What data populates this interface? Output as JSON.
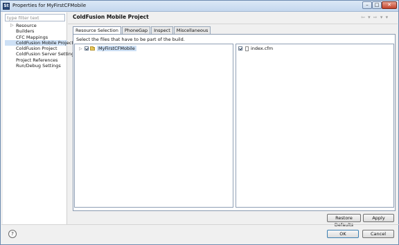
{
  "window": {
    "title": "Properties for MyFirstCFMobile",
    "app_icon": "St",
    "controls": {
      "minimize": "–",
      "maximize": "□",
      "close": "✕"
    }
  },
  "sidebar": {
    "filter_placeholder": "type filter text",
    "items": [
      {
        "label": "Resource",
        "expandable": true,
        "selected": false
      },
      {
        "label": "Builders",
        "expandable": false,
        "selected": false
      },
      {
        "label": "CFC Mappings",
        "expandable": false,
        "selected": false
      },
      {
        "label": "ColdFusion Mobile Project",
        "expandable": false,
        "selected": true
      },
      {
        "label": "ColdFusion Project",
        "expandable": false,
        "selected": false
      },
      {
        "label": "ColdFusion Server Settings",
        "expandable": false,
        "selected": false
      },
      {
        "label": "Project References",
        "expandable": false,
        "selected": false
      },
      {
        "label": "Run/Debug Settings",
        "expandable": false,
        "selected": false
      }
    ]
  },
  "main": {
    "title": "ColdFusion Mobile Project",
    "nav_icons": "⇦ ▾ ⇨ ▾ ▾",
    "tabs": [
      {
        "label": "Resource Selection",
        "active": true
      },
      {
        "label": "PhoneGap",
        "active": false
      },
      {
        "label": "Inspect",
        "active": false
      },
      {
        "label": "Miscellaneous",
        "active": false
      }
    ],
    "instructions": "Select the files that have to be part of the build.",
    "tree": {
      "expander": "▷",
      "project": "MyFirstCFMobile",
      "checked": true
    },
    "files": [
      {
        "name": "index.cfm",
        "checked": true
      }
    ]
  },
  "buttons": {
    "restore_defaults": "Restore Defaults",
    "apply": "Apply",
    "ok": "OK",
    "cancel": "Cancel",
    "help": "?"
  }
}
